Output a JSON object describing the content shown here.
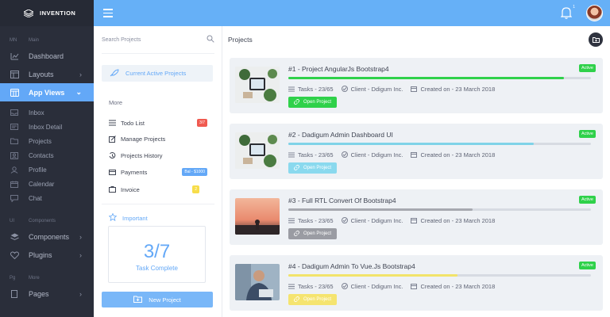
{
  "brand": {
    "name": "INVENTION"
  },
  "sidebar": {
    "sections": [
      {
        "abbr": "MN",
        "label": "Main"
      },
      {
        "abbr": "UI",
        "label": "Components"
      },
      {
        "abbr": "Pg",
        "label": "More"
      }
    ],
    "nav": [
      {
        "label": "Dashboard",
        "icon": "dashboard-icon"
      },
      {
        "label": "Layouts",
        "icon": "layout-icon",
        "chevron": true
      },
      {
        "label": "App Views",
        "icon": "app-views-icon",
        "chevron": true,
        "active": true
      },
      {
        "label": "Components",
        "icon": "components-icon",
        "chevron": true
      },
      {
        "label": "Plugins",
        "icon": "plugins-icon",
        "chevron": true
      },
      {
        "label": "Pages",
        "icon": "pages-icon",
        "chevron": true
      }
    ],
    "subnav": [
      {
        "label": "Inbox",
        "icon": "inbox-icon"
      },
      {
        "label": "Inbox Detail",
        "icon": "inbox-detail-icon"
      },
      {
        "label": "Projects",
        "icon": "projects-icon"
      },
      {
        "label": "Contacts",
        "icon": "contacts-icon"
      },
      {
        "label": "Profile",
        "icon": "profile-icon"
      },
      {
        "label": "Calendar",
        "icon": "calendar-icon"
      },
      {
        "label": "Chat",
        "icon": "chat-icon"
      }
    ]
  },
  "topbar": {
    "notification_count": "1",
    "icons": [
      "menu-icon",
      "bell-icon",
      "user-avatar"
    ]
  },
  "middle": {
    "search_placeholder": "Search Projects",
    "active_projects": "Current Active Projects",
    "more_label": "More",
    "items": [
      {
        "label": "Todo List",
        "badge": "3/7",
        "badge_color": "#f05a50"
      },
      {
        "label": "Manage Projects"
      },
      {
        "label": "Projects History"
      },
      {
        "label": "Payments",
        "badge": "Bal - $1000",
        "badge_color": "#63a8f7"
      },
      {
        "label": "Invoice",
        "badge": "2",
        "badge_color": "#f7dd4a"
      }
    ],
    "important_label": "Important",
    "task_count": "3/7",
    "task_label": "Task Complete",
    "new_project": "New Project"
  },
  "main": {
    "title": "Projects",
    "cards": [
      {
        "title": "#1 - Project AngularJs Bootstrap4",
        "status": "Active",
        "progress": 0.91,
        "bar_color": "#2fd14a",
        "tasks": "Tasks - 23/65",
        "client": "Client - Ddigum Inc.",
        "created": "Created on - 23 March 2018",
        "button": "Open Project",
        "button_color": "#2fd14a"
      },
      {
        "title": "#2 - Dadigum Admin Dashboard UI",
        "status": "Active",
        "progress": 0.81,
        "bar_color": "#7fd3e8",
        "tasks": "Tasks - 23/65",
        "client": "Client - Ddigum Inc.",
        "created": "Created on - 23 March 2018",
        "button": "Open Project",
        "button_color": "#8ad9ee"
      },
      {
        "title": "#3 - Full RTL Convert Of Bootstrap4",
        "status": "Active",
        "progress": 0.61,
        "bar_color": "#a7a9b0",
        "tasks": "Tasks - 23/65",
        "client": "Client - Ddigum Inc.",
        "created": "Created on - 23 March 2018",
        "button": "Open Project",
        "button_color": "#9a9ca3"
      },
      {
        "title": "#4 - Dadigum Admin To Vue.Js Bootstrap4",
        "status": "Active",
        "progress": 0.56,
        "bar_color": "#f2e36a",
        "tasks": "Tasks - 23/65",
        "client": "Client - Ddigum Inc.",
        "created": "Created on - 23 March 2018",
        "button": "Open Project",
        "button_color": "#f5e470"
      }
    ]
  }
}
